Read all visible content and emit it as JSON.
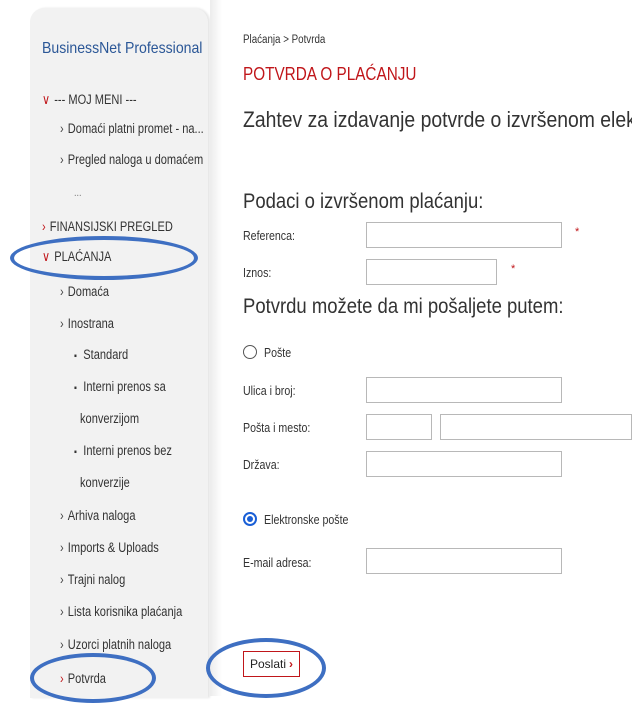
{
  "sidebar": {
    "brand": "BusinessNet Professional",
    "items": [
      {
        "label": "--- MOJ MENI ---",
        "chev": "∨"
      },
      {
        "label": "Domaći platni promet - na...",
        "chev": "›"
      },
      {
        "label": "Pregled naloga u domaćem",
        "chev": "›"
      },
      {
        "label": "...",
        "chev": ""
      },
      {
        "label": "FINANSIJSKI PREGLED",
        "chev": "›"
      },
      {
        "label": "PLAĆANJA",
        "chev": "∨"
      },
      {
        "label": "Domaća",
        "chev": "›"
      },
      {
        "label": "Inostrana",
        "chev": "›"
      },
      {
        "label": "Standard",
        "chev": ""
      },
      {
        "label": "Interni prenos sa",
        "chev": ""
      },
      {
        "label": "konverzijom",
        "chev": ""
      },
      {
        "label": "Interni prenos bez",
        "chev": ""
      },
      {
        "label": "konverzije",
        "chev": ""
      },
      {
        "label": "Arhiva naloga",
        "chev": "›"
      },
      {
        "label": "Imports & Uploads",
        "chev": "›"
      },
      {
        "label": "Trajni nalog",
        "chev": "›"
      },
      {
        "label": "Lista korisnika plaćanja",
        "chev": "›"
      },
      {
        "label": "Uzorci platnih naloga",
        "chev": "›"
      },
      {
        "label": "Potvrda",
        "chev": "›"
      }
    ]
  },
  "breadcrumb": "Plaćanja  >  Potvrda",
  "page_title": "POTVRDA O PLAĆANJU",
  "main_heading": "Zahtev za izdavanje potvrde o izvršenom elektro",
  "section_payment": "Podaci o izvršenom plaćanju:",
  "fields": {
    "reference_label": "Referenca:",
    "reference_value": "",
    "amount_label": "Iznos:",
    "amount_value": "",
    "required_mark": "*"
  },
  "section_delivery": "Potvrdu možete da mi pošaljete putem:",
  "delivery": {
    "post_label": "Pošte",
    "street_label": "Ulica i broj:",
    "city_label": "Pošta i mesto:",
    "country_label": "Država:",
    "email_option_label": "Elektronske pošte",
    "email_label": "E-mail adresa:",
    "selected": "email"
  },
  "submit_label": "Poslati",
  "submit_arrow": "›",
  "colors": {
    "accent": "#c0161a",
    "brand": "#2b5797",
    "annotation": "#3e6fc2",
    "radio_selected": "#1a5fd6"
  }
}
